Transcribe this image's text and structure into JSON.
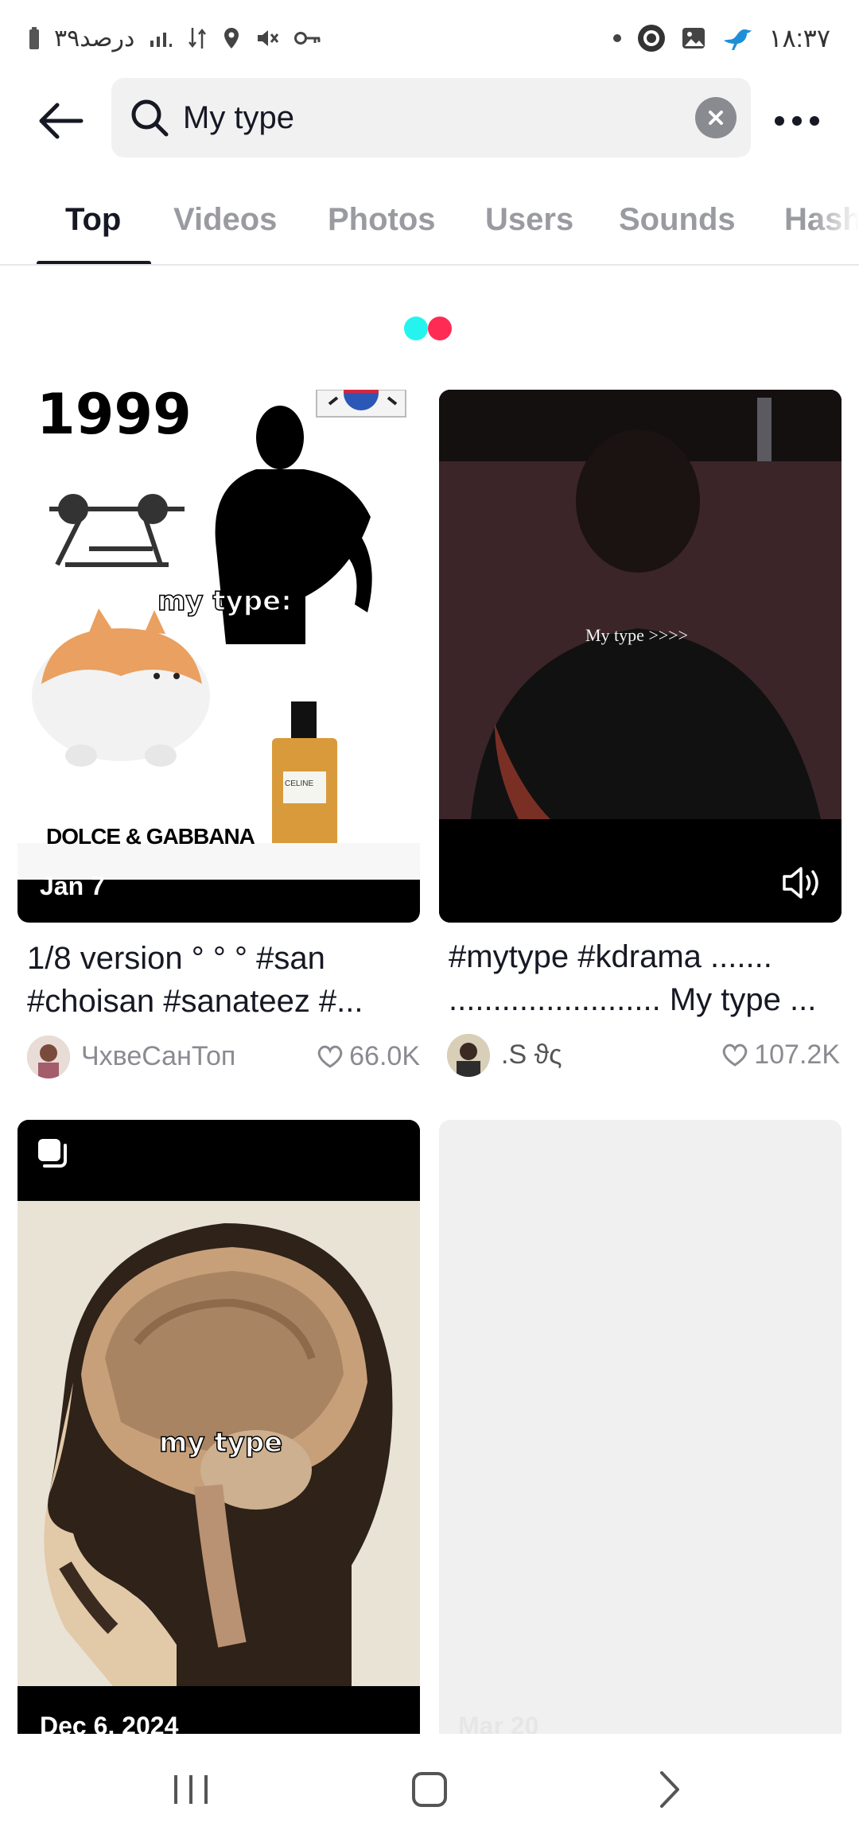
{
  "status_bar": {
    "left_text": "۳۹درصد",
    "time": "۱۸:۳۷"
  },
  "search": {
    "query": "My type"
  },
  "tabs": [
    {
      "label": "Top",
      "active": true
    },
    {
      "label": "Videos",
      "active": false
    },
    {
      "label": "Photos",
      "active": false
    },
    {
      "label": "Users",
      "active": false
    },
    {
      "label": "Sounds",
      "active": false
    },
    {
      "label": "Hashtags",
      "active": false
    }
  ],
  "loader": {
    "colors": [
      "#25f4ee",
      "#fe2c55"
    ]
  },
  "cards": [
    {
      "thumb_texts": {
        "year": "1999",
        "overlay": "my type:",
        "brand": "DOLCE & GABBANA",
        "perfume": "CELINE"
      },
      "date": "Jan 7",
      "caption_line1": "1/8 version ° ° ° #san",
      "caption_line2": "#choisan #sanateez #...",
      "author": "ЧхвеСанТоп",
      "likes": "66.0K"
    },
    {
      "thumb_texts": {
        "overlay": "My type >>>>"
      },
      "caption_line1": "#mytype #kdrama .......",
      "caption_line2": "........................ My type ...",
      "author": ".S ϑς",
      "likes": "107.2K",
      "icon": "volume-icon"
    },
    {
      "thumb_texts": {
        "overlay": "my type"
      },
      "date": "Dec 6, 2024",
      "icon": "photo-carousel-icon"
    },
    {
      "date": "Mar 20"
    }
  ]
}
